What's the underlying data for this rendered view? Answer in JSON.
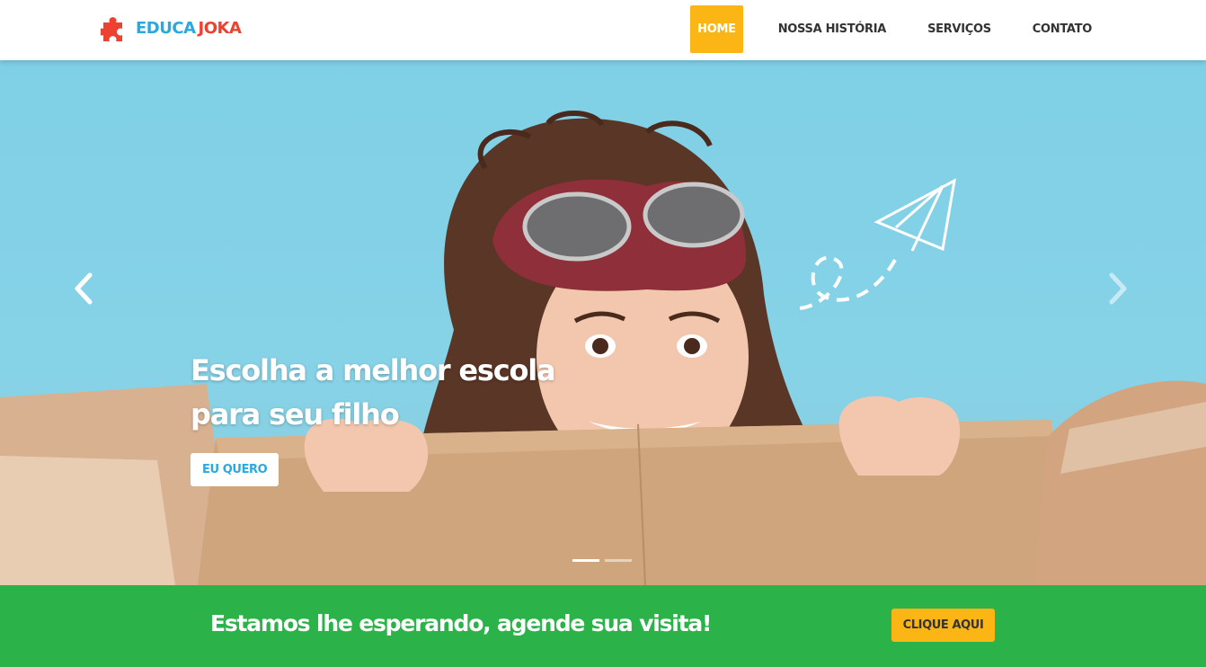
{
  "brand": {
    "logo_icon": "puzzle-piece-icon",
    "part1": "EDUCA",
    "part2": "JOKA",
    "color1": "#29a9e0",
    "color2": "#ef4130"
  },
  "nav": {
    "items": [
      {
        "label": "HOME",
        "active": true
      },
      {
        "label": "NOSSA HISTÓRIA",
        "active": false
      },
      {
        "label": "SERVIÇOS",
        "active": false
      },
      {
        "label": "CONTATO",
        "active": false
      }
    ]
  },
  "hero": {
    "title_line1": "Escolha a melhor escola",
    "title_line2": "para seu filho",
    "button_label": "EU QUERO",
    "prev_icon": "chevron-left-icon",
    "next_icon": "chevron-right-icon",
    "slides_total": 2,
    "active_slide": 1
  },
  "band": {
    "text": "Estamos lhe esperando, agende sua visita!",
    "button_label": "CLIQUE AQUI"
  },
  "colors": {
    "accent": "#fbb615",
    "green": "#2bb34a",
    "sky": "#86d2e7"
  }
}
